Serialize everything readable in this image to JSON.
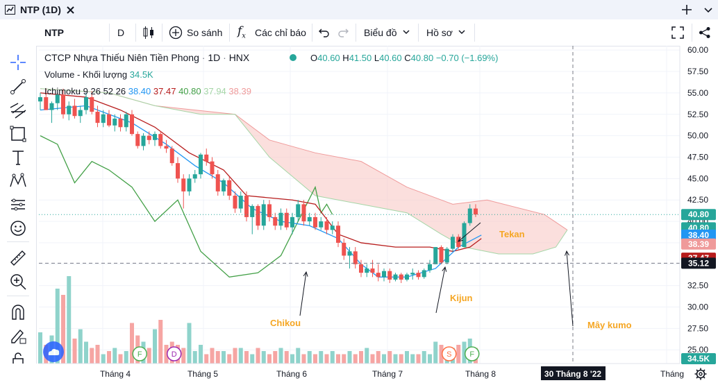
{
  "window": {
    "tab_title": "NTP (1D)"
  },
  "toolbar": {
    "symbol": "NTP",
    "interval": "D",
    "compare_label": "So sánh",
    "indicators_label": "Các chỉ báo",
    "chart_type_label": "Biểu đồ",
    "profile_label": "Hồ sơ"
  },
  "legend": {
    "name": "CTCP Nhựa Thiếu Niên Tiền Phong",
    "interval": "1D",
    "exchange": "HNX",
    "open_label": "O",
    "open": "40.60",
    "high_label": "H",
    "high": "41.50",
    "low_label": "L",
    "low": "40.60",
    "close_label": "C",
    "close": "40.80",
    "change": "−0.70 (−1.69%)",
    "volume_label": "Volume - Khối lượng",
    "volume_value": "34.5K",
    "ichimoku_label": "Ichimoku",
    "ichimoku_params": "9 26 52 26",
    "ichimoku_values": [
      "38.40",
      "37.47",
      "40.80",
      "37.94",
      "38.39"
    ]
  },
  "chart_data": {
    "type": "candlestick",
    "y_ticks": [
      "60.00",
      "57.50",
      "55.00",
      "52.50",
      "50.00",
      "47.50",
      "45.00",
      "42.50",
      "40.00",
      "37.50",
      "35.00",
      "32.50",
      "30.00",
      "27.50",
      "25.00"
    ],
    "ylim": [
      23.4,
      60.5
    ],
    "x_labels": [
      "Tháng 4",
      "Tháng 5",
      "Tháng 6",
      "Tháng 7",
      "Tháng 8",
      "Tháng"
    ],
    "crosshair_date": "30 Tháng 8 '22",
    "price_tags": [
      {
        "value": "40.80",
        "color": "#26a69a",
        "y": 40.8
      },
      {
        "value": "40.80",
        "color": "#26a69a",
        "y": 39.25
      },
      {
        "value": "38.40",
        "color": "#2196f3",
        "y": 38.4
      },
      {
        "value": "38.39",
        "color": "#ef9a9a",
        "y": 37.35
      },
      {
        "value": "37.47",
        "color": "#b71c1c",
        "y": 35.7
      },
      {
        "value": "35.12",
        "color": "#131722",
        "y": 35.12
      },
      {
        "value": "34.5K",
        "color": "#26a69a",
        "y": 24.8
      }
    ],
    "candles": [
      [
        54,
        55,
        53,
        54.5
      ],
      [
        54.5,
        55.5,
        53,
        53
      ],
      [
        53,
        54,
        51.5,
        53.8
      ],
      [
        53.8,
        55,
        53,
        54.8
      ],
      [
        54.8,
        55.5,
        52,
        52.5
      ],
      [
        52.5,
        54,
        51.8,
        53.5
      ],
      [
        53.5,
        54.3,
        52,
        52.3
      ],
      [
        52.3,
        53.5,
        51.5,
        53
      ],
      [
        53,
        55,
        52.5,
        54.5
      ],
      [
        54.5,
        55.2,
        52.5,
        52.8
      ],
      [
        52.8,
        53.5,
        51,
        51.5
      ],
      [
        51.5,
        53,
        51,
        52.5
      ],
      [
        52.5,
        53,
        51,
        51.2
      ],
      [
        51.2,
        52.5,
        50.5,
        52
      ],
      [
        52,
        52.5,
        50.5,
        51
      ],
      [
        51,
        52.8,
        50.5,
        52.5
      ],
      [
        52.5,
        53,
        50,
        50.2
      ],
      [
        50.2,
        50.5,
        48.5,
        48.8
      ],
      [
        48.8,
        50.3,
        48.3,
        50
      ],
      [
        50,
        50.5,
        49,
        49.5
      ],
      [
        49.5,
        50.5,
        48.8,
        50.2
      ],
      [
        50.2,
        50.5,
        48.5,
        48.8
      ],
      [
        48.8,
        49.5,
        48,
        48.5
      ],
      [
        48.5,
        48.8,
        46.5,
        46.8
      ],
      [
        46.8,
        47.5,
        44.5,
        45
      ],
      [
        45,
        45.5,
        41.5,
        43.5
      ],
      [
        43.5,
        45.5,
        43,
        45
      ],
      [
        45,
        46,
        44.5,
        45.5
      ],
      [
        45.5,
        48,
        45,
        47.8
      ],
      [
        47.8,
        48.5,
        46.5,
        47
      ],
      [
        47,
        47.5,
        45,
        45.5
      ],
      [
        45.5,
        46,
        43,
        43.5
      ],
      [
        43.5,
        45,
        43,
        44.8
      ],
      [
        44.8,
        45.2,
        42.5,
        43
      ],
      [
        43,
        43.5,
        41,
        41.5
      ],
      [
        41.5,
        43.5,
        41,
        43
      ],
      [
        43,
        43.5,
        40,
        40.5
      ],
      [
        40.5,
        42,
        38.5,
        41.8
      ],
      [
        41.8,
        42,
        39,
        39.5
      ],
      [
        39.5,
        42.5,
        39,
        42
      ],
      [
        42,
        42.5,
        40,
        40.5
      ],
      [
        40.5,
        41,
        39,
        39.5
      ],
      [
        39.5,
        41.5,
        39,
        41
      ],
      [
        41,
        41.5,
        39,
        39.3
      ],
      [
        39.3,
        41,
        38.5,
        40.5
      ],
      [
        40.5,
        42.5,
        40,
        42
      ],
      [
        42,
        42.5,
        39.5,
        40
      ],
      [
        40,
        41,
        39.5,
        40.5
      ],
      [
        40.5,
        41,
        39,
        39.3
      ],
      [
        39.3,
        40.5,
        39,
        40
      ],
      [
        40,
        40.5,
        38.5,
        39
      ],
      [
        39,
        40,
        38.5,
        39.5
      ],
      [
        39.5,
        40,
        37,
        37.5
      ],
      [
        37.5,
        38,
        35.5,
        36
      ],
      [
        36,
        37,
        34.5,
        36.5
      ],
      [
        36.5,
        37,
        34.5,
        35
      ],
      [
        35,
        35.5,
        33.5,
        34
      ],
      [
        34,
        35,
        33.5,
        34.5
      ],
      [
        34.5,
        35.5,
        33.5,
        34
      ],
      [
        34,
        35,
        33,
        33.5
      ],
      [
        33.5,
        34.5,
        33,
        34.2
      ],
      [
        34.2,
        34.5,
        32.8,
        33.2
      ],
      [
        33.2,
        34,
        33,
        33.8
      ],
      [
        33.8,
        34,
        32.8,
        33.2
      ],
      [
        33.2,
        34,
        33,
        33.8
      ],
      [
        33.8,
        34.5,
        33.2,
        34
      ],
      [
        34,
        34.3,
        33.2,
        33.5
      ],
      [
        33.5,
        34.5,
        33.3,
        34.3
      ],
      [
        34.3,
        35.5,
        34,
        35
      ],
      [
        35,
        37,
        35,
        37
      ],
      [
        37,
        37.2,
        35,
        35.2
      ],
      [
        35.2,
        37,
        35,
        36.8
      ],
      [
        36.8,
        38.5,
        36.5,
        38.2
      ],
      [
        38.2,
        38.5,
        36.8,
        37
      ],
      [
        37,
        40,
        37,
        39.8
      ],
      [
        39.8,
        42,
        39.5,
        41.5
      ],
      [
        41.5,
        42,
        40.5,
        40.8
      ]
    ],
    "volumes": [
      10,
      6,
      9,
      24,
      22,
      28,
      8,
      11,
      7,
      5,
      6,
      3,
      4,
      5,
      3,
      4,
      13,
      9,
      7,
      5,
      11,
      14,
      6,
      7,
      6,
      5,
      13,
      4,
      6,
      3,
      5,
      4,
      4,
      3,
      5,
      5,
      4,
      3,
      5,
      4,
      3,
      4,
      5,
      4,
      3,
      5,
      3,
      4,
      3,
      4,
      3,
      4,
      3,
      3,
      4,
      3,
      4,
      5,
      3,
      4,
      3,
      4,
      3,
      3,
      4,
      3,
      3,
      4,
      3,
      7,
      6,
      4,
      5,
      6,
      7,
      8,
      5
    ],
    "tenkan": [
      [
        0,
        53
      ],
      [
        8,
        53.5
      ],
      [
        12,
        52.5
      ],
      [
        16,
        51.5
      ],
      [
        22,
        49
      ],
      [
        27,
        46.5
      ],
      [
        32,
        44.5
      ],
      [
        37,
        41.5
      ],
      [
        42,
        40
      ],
      [
        47,
        39.5
      ],
      [
        52,
        38
      ],
      [
        56,
        35
      ],
      [
        59,
        33.5
      ],
      [
        64,
        33.5
      ],
      [
        69,
        34.5
      ],
      [
        73,
        37
      ],
      [
        77,
        38.4
      ]
    ],
    "kijun": [
      [
        0,
        55
      ],
      [
        8,
        54.5
      ],
      [
        14,
        53
      ],
      [
        20,
        51
      ],
      [
        26,
        48
      ],
      [
        32,
        46
      ],
      [
        36,
        43
      ],
      [
        44,
        42.5
      ],
      [
        48,
        42
      ],
      [
        52,
        38.5
      ],
      [
        56,
        37.5
      ],
      [
        62,
        37
      ],
      [
        68,
        37
      ],
      [
        72,
        36.5
      ],
      [
        75,
        37
      ],
      [
        77,
        38
      ]
    ],
    "chikou": [
      [
        0,
        50
      ],
      [
        3,
        49
      ],
      [
        6,
        44.5
      ],
      [
        9,
        47
      ],
      [
        12,
        46
      ],
      [
        16,
        44
      ],
      [
        20,
        40
      ],
      [
        24,
        42.5
      ],
      [
        28,
        36.5
      ],
      [
        33,
        33.5
      ],
      [
        38,
        34
      ],
      [
        42,
        36
      ],
      [
        45,
        40
      ],
      [
        48,
        44
      ],
      [
        49,
        41
      ],
      [
        50,
        42
      ],
      [
        51,
        40.8
      ]
    ],
    "cloud_a": [
      [
        0,
        55.5
      ],
      [
        12,
        55
      ],
      [
        20,
        53.5
      ],
      [
        34,
        52.5
      ],
      [
        40,
        49.5
      ],
      [
        48,
        48
      ],
      [
        56,
        47
      ],
      [
        64,
        44
      ],
      [
        72,
        42
      ],
      [
        78,
        42.5
      ],
      [
        88,
        40.8
      ],
      [
        92,
        39
      ]
    ],
    "cloud_b": [
      [
        0,
        55.5
      ],
      [
        12,
        55
      ],
      [
        20,
        53.5
      ],
      [
        28,
        52.5
      ],
      [
        34,
        52.5
      ],
      [
        40,
        47.5
      ],
      [
        48,
        43
      ],
      [
        56,
        42
      ],
      [
        64,
        41
      ],
      [
        70,
        38.5
      ],
      [
        74,
        37
      ],
      [
        80,
        36.2
      ],
      [
        86,
        36.2
      ],
      [
        90,
        37
      ],
      [
        92,
        39
      ]
    ],
    "annotations": {
      "tekan": "Tekan",
      "kijun": "Kijun",
      "chikou": "Chikou",
      "kumo": "Mây kumo"
    },
    "event_markers": [
      {
        "label": "F",
        "color": "#4caf50",
        "i": 17
      },
      {
        "label": "D",
        "color": "#9c27b0",
        "i": 23
      },
      {
        "label": "S",
        "color": "#ff7043",
        "i": 71
      },
      {
        "label": "F",
        "color": "#4caf50",
        "i": 75
      }
    ],
    "colors": {
      "up": "#26a69a",
      "down": "#ef5350",
      "tenkan": "#2196f3",
      "kijun": "#b71c1c",
      "chikou": "#43a047",
      "cloud": "#f8c9c6",
      "up_vol": "#8fd3cb",
      "down_vol": "#f6a5a3",
      "annotation": "#f5a623"
    }
  }
}
